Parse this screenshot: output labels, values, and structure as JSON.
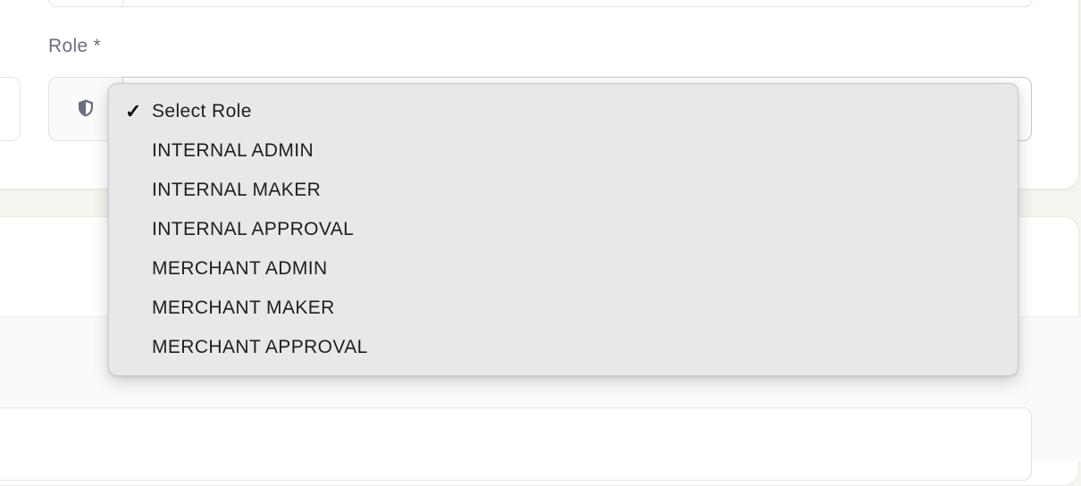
{
  "form": {
    "role_label": "Role *",
    "role_select": {
      "selected": "Select Role",
      "icon": "shield-icon"
    }
  },
  "dropdown": {
    "options": [
      {
        "label": "Select Role",
        "checked": true
      },
      {
        "label": "INTERNAL ADMIN",
        "checked": false
      },
      {
        "label": "INTERNAL MAKER",
        "checked": false
      },
      {
        "label": "INTERNAL APPROVAL",
        "checked": false
      },
      {
        "label": "MERCHANT ADMIN",
        "checked": false
      },
      {
        "label": "MERCHANT MAKER",
        "checked": false
      },
      {
        "label": "MERCHANT APPROVAL",
        "checked": false
      }
    ],
    "check_glyph": "✓"
  },
  "colors": {
    "page_background": "#f6f4ee",
    "card_background": "#ffffff",
    "menu_background": "#e8e8ea",
    "label_text": "#6b6e80",
    "menu_text": "#1e1e1e",
    "icon_gray": "#6b6e80"
  }
}
